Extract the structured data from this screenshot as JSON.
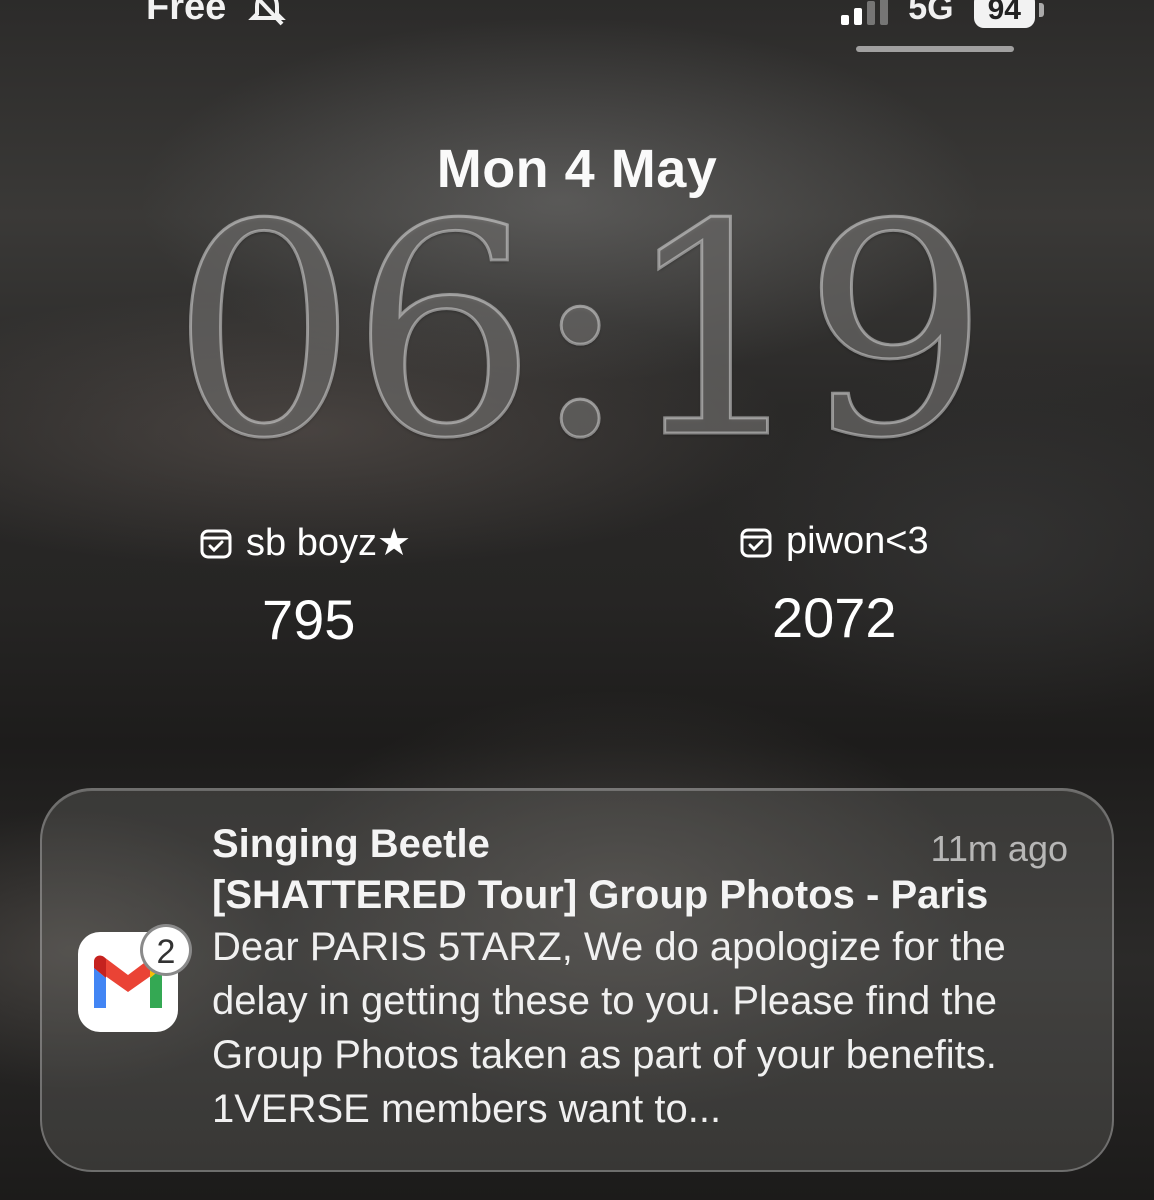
{
  "status_bar": {
    "carrier": "Free",
    "network": "5G",
    "battery": "94",
    "signal_bars_active": 2,
    "signal_bars_total": 4
  },
  "lock_screen": {
    "date": "Mon 4 May",
    "time": "06:19"
  },
  "widgets": [
    {
      "label": "sb boyz★",
      "value": "795",
      "icon": "calendar-icon"
    },
    {
      "label": "piwon<3",
      "value": "2072",
      "icon": "calendar-icon"
    }
  ],
  "notification": {
    "app_icon": "gmail-icon",
    "badge_count": "2",
    "sender": "Singing Beetle",
    "time_ago": "11m ago",
    "subject": "[SHATTERED Tour] Group Photos - Paris",
    "message": "Dear PARIS 5TARZ, We do apologize for the delay in getting these to you. Please find the Group Photos taken as part of your benefits. 1VERSE members want to..."
  }
}
